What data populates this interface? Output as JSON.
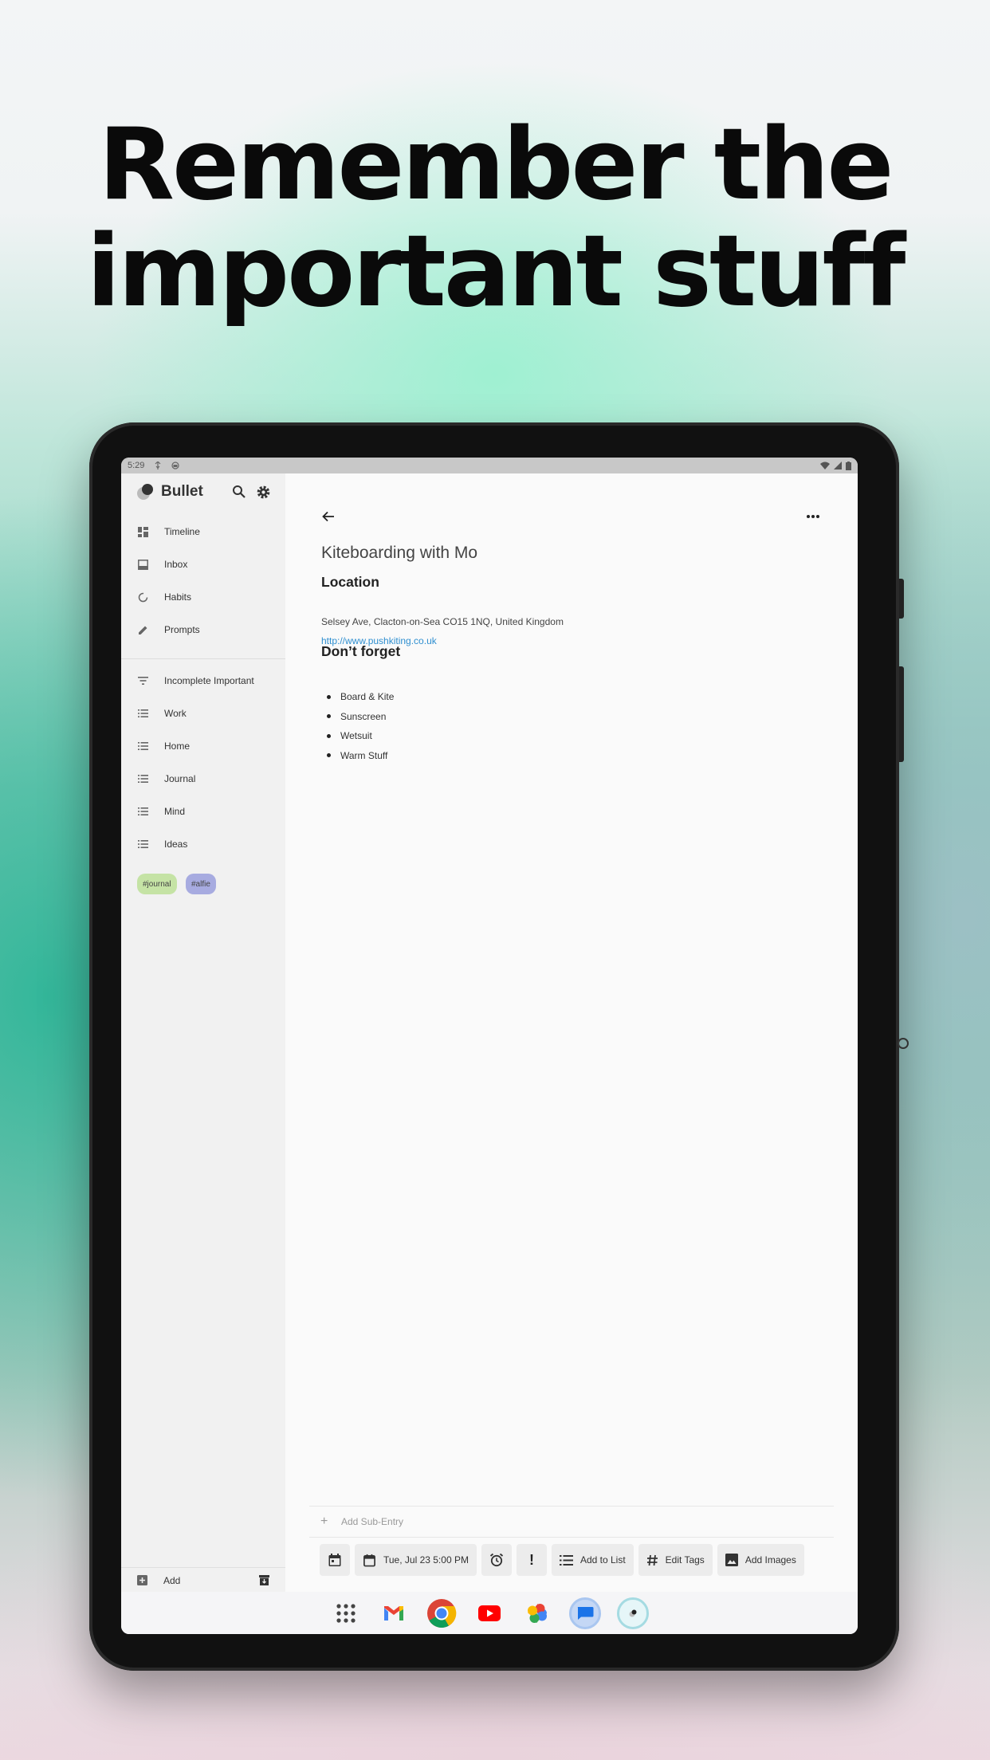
{
  "headline": {
    "line1": "Remember the",
    "line2": "important stuff"
  },
  "status_bar": {
    "time": "5:29"
  },
  "sidebar": {
    "app_name": "Bullet",
    "nav_items": [
      {
        "label": "Timeline",
        "icon": "dashboard-icon"
      },
      {
        "label": "Inbox",
        "icon": "inbox-icon"
      },
      {
        "label": "Habits",
        "icon": "habit-icon"
      },
      {
        "label": "Prompts",
        "icon": "pencil-icon"
      }
    ],
    "lists": [
      {
        "label": "Incomplete Important",
        "icon": "filter-icon"
      },
      {
        "label": "Work",
        "icon": "list-icon"
      },
      {
        "label": "Home",
        "icon": "list-icon"
      },
      {
        "label": "Journal",
        "icon": "list-icon"
      },
      {
        "label": "Mind",
        "icon": "list-icon"
      },
      {
        "label": "Ideas",
        "icon": "list-icon"
      }
    ],
    "tags": [
      {
        "label": "#journal",
        "color": "#c5e3a5"
      },
      {
        "label": "#alfie",
        "color": "#a7abe0"
      }
    ],
    "add_label": "Add"
  },
  "entry": {
    "title": "Kiteboarding with Mo",
    "section1_heading": "Location",
    "address": "Selsey Ave, Clacton-on-Sea CO15 1NQ, United Kingdom",
    "url": "http://www.pushkiting.co.uk",
    "section2_heading": "Don’t forget",
    "checklist": [
      "Board & Kite",
      "Sunscreen",
      "Wetsuit",
      "Warm Stuff"
    ]
  },
  "bottom": {
    "add_sub_entry": "Add Sub-Entry",
    "date_chip": "Tue, Jul 23 5:00 PM",
    "add_to_list": "Add to List",
    "edit_tags": "Edit Tags",
    "add_images": "Add Images",
    "important_symbol": "!"
  },
  "dock_apps": [
    "app-drawer-icon",
    "gmail-icon",
    "chrome-icon",
    "youtube-icon",
    "photos-icon",
    "messages-icon",
    "bullet-app-icon"
  ],
  "colors": {
    "link": "#2f8fd0",
    "sidebar_bg": "#f1f1f1",
    "chip_bg": "#ececec"
  }
}
